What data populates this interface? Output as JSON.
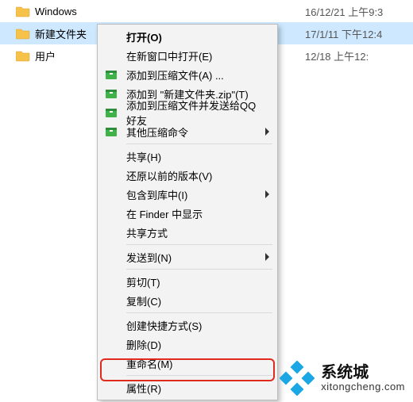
{
  "files": [
    {
      "name": "Windows",
      "date": "16/12/21 上午9:3"
    },
    {
      "name": "新建文件夹",
      "date": "17/1/11 下午12:4"
    },
    {
      "name": "用户",
      "date": "12/18 上午12:"
    }
  ],
  "menu": {
    "open": "打开(O)",
    "open_new_window": "在新窗口中打开(E)",
    "add_archive": "添加到压缩文件(A) ...",
    "add_zip": "添加到 \"新建文件夹.zip\"(T)",
    "send_qq": "添加到压缩文件并发送给QQ好友",
    "other_compress": "其他压缩命令",
    "share_h": "共享(H)",
    "restore_prev": "还原以前的版本(V)",
    "include_library": "包含到库中(I)",
    "show_finder": "在 Finder 中显示",
    "share_way": "共享方式",
    "send_to": "发送到(N)",
    "cut": "剪切(T)",
    "copy": "复制(C)",
    "shortcut": "创建快捷方式(S)",
    "delete": "删除(D)",
    "rename": "重命名(M)",
    "properties": "属性(R)"
  },
  "watermark": {
    "brand": "系统城",
    "site": "xitongcheng.com"
  },
  "colors": {
    "selection": "#cde8ff",
    "highlight_border": "#e02a1d",
    "logo": "#1aa7e3"
  }
}
